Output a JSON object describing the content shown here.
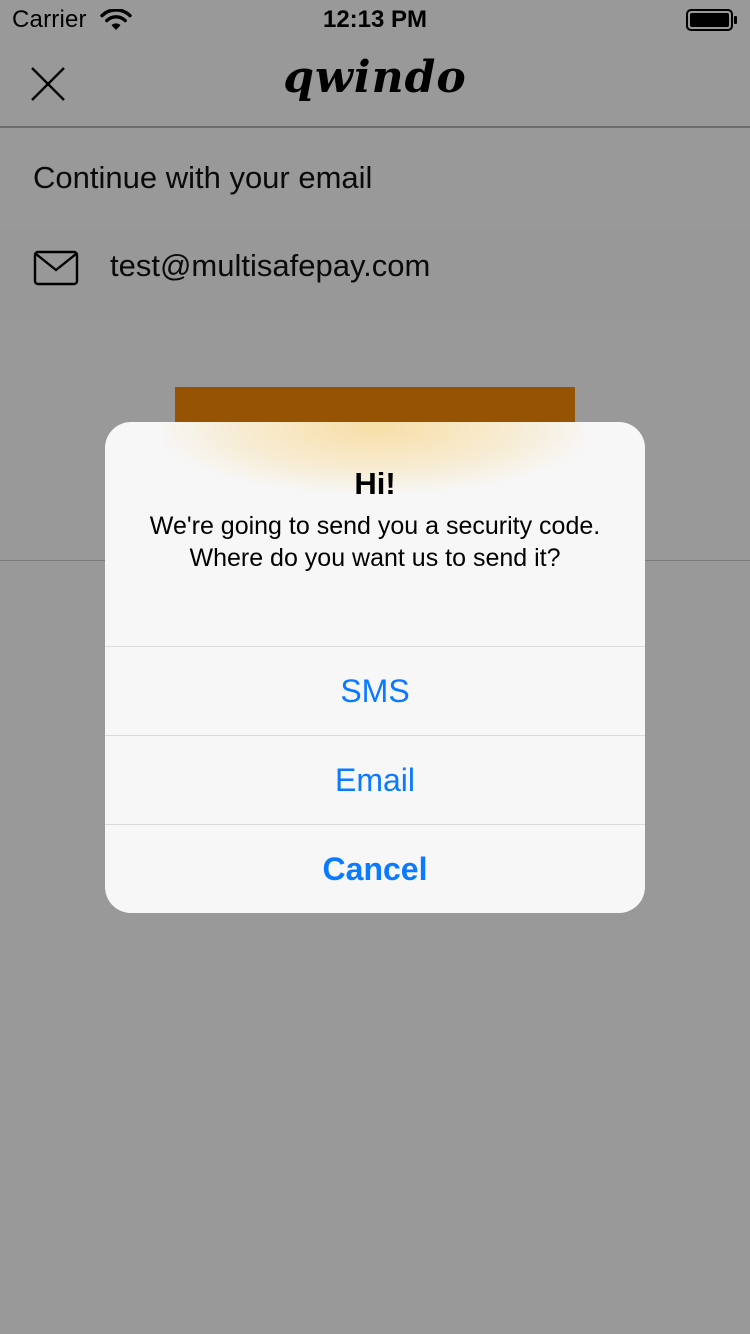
{
  "status_bar": {
    "carrier": "Carrier",
    "time": "12:13 PM"
  },
  "nav": {
    "brand": "qwindo",
    "close_icon": "close-icon"
  },
  "form": {
    "section_title": "Continue with your email",
    "email_icon": "mail-icon",
    "email_value": "test@multisafepay.com",
    "button_color": "#f98a05"
  },
  "alert": {
    "title": "Hi!",
    "message": "We're going to send you a security code. Where do you want us to send it?",
    "actions": [
      {
        "label": "SMS"
      },
      {
        "label": "Email"
      },
      {
        "label": "Cancel"
      }
    ],
    "action_color": "#0a7aff"
  }
}
